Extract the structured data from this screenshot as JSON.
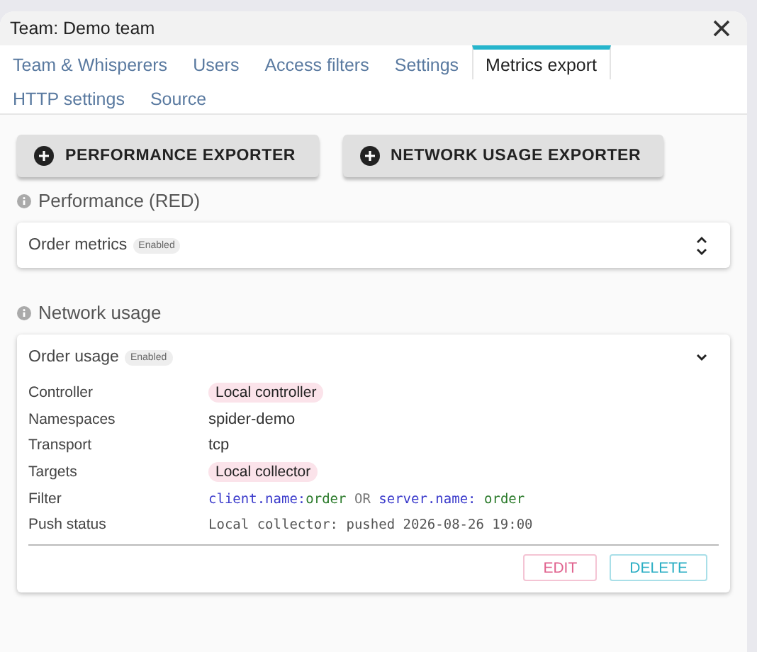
{
  "window": {
    "title": "Team: Demo team"
  },
  "tabs": [
    {
      "label": "Team & Whisperers",
      "selected": false
    },
    {
      "label": "Users",
      "selected": false
    },
    {
      "label": "Access filters",
      "selected": false
    },
    {
      "label": "Settings",
      "selected": false
    },
    {
      "label": "Metrics export",
      "selected": true
    },
    {
      "label": "HTTP settings",
      "selected": false
    },
    {
      "label": "Source",
      "selected": false
    }
  ],
  "actions": [
    "PERFORMANCE EXPORTER",
    "NETWORK USAGE EXPORTER"
  ],
  "sections": [
    {
      "title": "Performance (RED)",
      "exporters": [
        {
          "name": "Order metrics",
          "badge": "Enabled",
          "expanded": false
        }
      ]
    },
    {
      "title": "Network usage",
      "exporters": [
        {
          "name": "Order usage",
          "badge": "Enabled",
          "expanded": true,
          "details": [
            {
              "label": "Controller",
              "kind": "chip",
              "value": "Local controller"
            },
            {
              "label": "Namespaces",
              "kind": "text",
              "value": "spider-demo"
            },
            {
              "label": "Transport",
              "kind": "text",
              "value": "tcp"
            },
            {
              "label": "Targets",
              "kind": "chip",
              "value": "Local collector"
            },
            {
              "label": "Filter",
              "kind": "query",
              "tokens": [
                {
                  "kind": "field",
                  "text": "client.name:"
                },
                {
                  "kind": "value",
                  "text": "order"
                },
                {
                  "kind": "op",
                  "text": " OR "
                },
                {
                  "kind": "field",
                  "text": "server.name:"
                },
                {
                  "kind": "value",
                  "text": " order"
                }
              ]
            },
            {
              "label": "Push status",
              "kind": "mono",
              "value": "Local collector: pushed 2026-08-26 19:00"
            }
          ],
          "buttons": [
            {
              "label": "EDIT",
              "kind": "edit"
            },
            {
              "label": "DELETE",
              "kind": "delete"
            }
          ]
        }
      ]
    }
  ]
}
